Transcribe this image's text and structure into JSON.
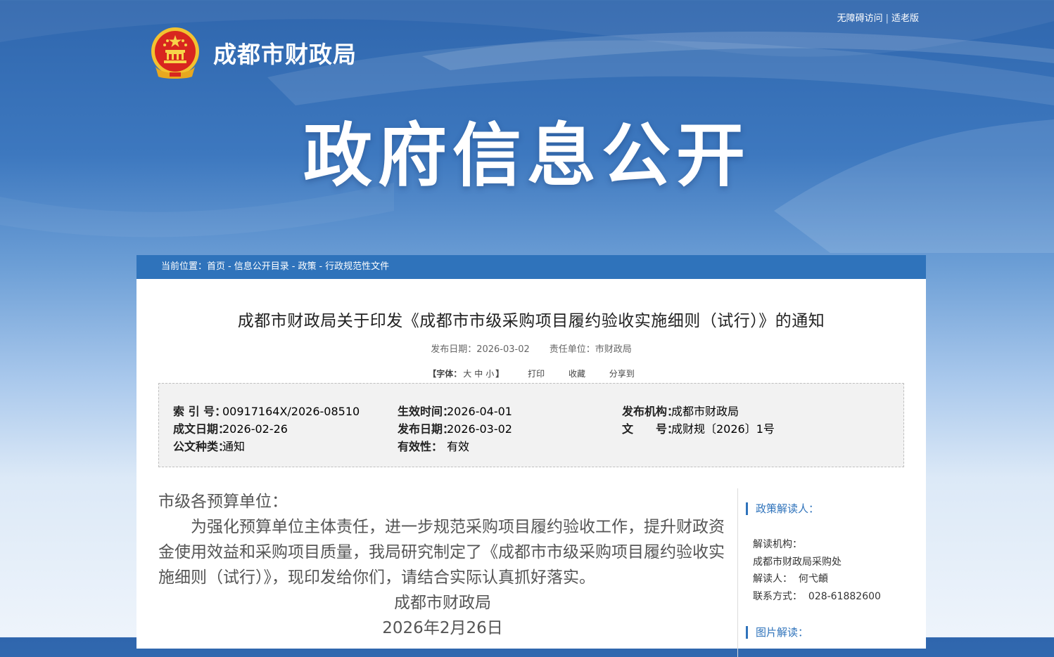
{
  "topbar": {
    "accessible": "无障碍访问",
    "separator": "|",
    "elderly": "适老版"
  },
  "site": {
    "name": "成都市财政局",
    "emblem": "national-emblem"
  },
  "banner": {
    "title": "政府信息公开"
  },
  "breadcrumb": {
    "prefix": "当前位置：",
    "items": [
      "首页",
      "信息公开目录",
      "政策",
      "行政规范性文件"
    ],
    "separator": "-"
  },
  "article": {
    "title": "成都市财政局关于印发《成都市市级采购项目履约验收实施细则（试行）》的通知",
    "publish_label": "发布日期：",
    "publish_date": "2026-03-02",
    "unit_label": "责任单位：",
    "unit": "市财政局"
  },
  "tools": {
    "font_label": "【字体：",
    "large": "大",
    "medium": "中",
    "small": "小",
    "font_close": "】",
    "print": "打印",
    "favorite": "收藏",
    "share": "分享到"
  },
  "info": {
    "index_label": "索 引 号：",
    "index": "00917164X/2026-08510",
    "effective_label": "生效时间：",
    "effective": "2026-04-01",
    "issuer_label": "发布机构：",
    "issuer": "成都市财政局",
    "written_label": "成文日期：",
    "written": "2026-02-26",
    "publish_label": "发布日期：",
    "publish": "2026-03-02",
    "docno_label": "文　　号：",
    "docno": "成财规〔2026〕1号",
    "type_label": "公文种类：",
    "type": "通知",
    "validity_label": "有效性：",
    "validity": "有效"
  },
  "body": {
    "salutation": "市级各预算单位：",
    "paragraph": "为强化预算单位主体责任，进一步规范采购项目履约验收工作，提升财政资金使用效益和采购项目质量，我局研究制定了《成都市市级采购项目履约验收实施细则（试行）》，现印发给你们，请结合实际认真抓好落实。",
    "signature": "成都市财政局",
    "date": "2026年2月26日"
  },
  "sidebar": {
    "heading": "政策解读人：",
    "org_label": "解读机构：",
    "org": "成都市财政局采购处",
    "person_label": "解读人：",
    "person": "何弋頔",
    "contact_label": "联系方式：",
    "contact": "028-61882600",
    "heading2": "图片解读："
  },
  "colors": {
    "accent": "#2f73bb",
    "banner_top": "#2f66ad"
  }
}
